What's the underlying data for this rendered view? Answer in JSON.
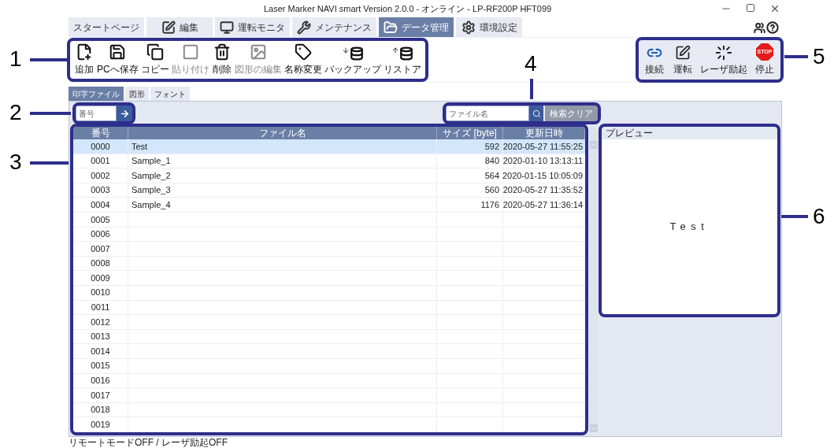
{
  "window": {
    "title": "Laser Marker NAVI smart  Version 2.0.0 - オンライン - LP-RF200P  HFT099"
  },
  "tabs": [
    {
      "label": "スタートページ",
      "selected": false
    },
    {
      "label": "編集",
      "selected": false
    },
    {
      "label": "運転モニタ",
      "selected": false
    },
    {
      "label": "メンテナンス",
      "selected": false
    },
    {
      "label": "データ管理",
      "selected": true
    },
    {
      "label": "環境設定",
      "selected": false
    }
  ],
  "toolbar": [
    {
      "label": "追加",
      "disabled": false
    },
    {
      "label": "PCへ保存",
      "disabled": false
    },
    {
      "label": "コピー",
      "disabled": false
    },
    {
      "label": "貼り付け",
      "disabled": true
    },
    {
      "label": "削除",
      "disabled": false
    },
    {
      "label": "図形の編集",
      "disabled": true
    },
    {
      "label": "名称変更",
      "disabled": false
    },
    {
      "label": "バックアップ",
      "disabled": false
    },
    {
      "label": "リストア",
      "disabled": false
    }
  ],
  "right_toolbar": [
    {
      "label": "接続"
    },
    {
      "label": "運転"
    },
    {
      "label": "レーザ励起"
    },
    {
      "label": "停止",
      "badge": "STOP"
    }
  ],
  "subtabs": [
    {
      "label": "印字ファイル",
      "selected": true
    },
    {
      "label": "図形",
      "selected": false
    },
    {
      "label": "フォント",
      "selected": false
    }
  ],
  "number_field": {
    "placeholder": "番号"
  },
  "search": {
    "placeholder": "ファイル名",
    "clear_button": "検索クリア"
  },
  "table": {
    "columns": [
      "番号",
      "ファイル名",
      "サイズ [byte]",
      "更新日時"
    ],
    "rows": [
      {
        "number": "0000",
        "name": "Test",
        "size": "592",
        "updated": "2020-05-27 11:55:25",
        "selected": true
      },
      {
        "number": "0001",
        "name": "Sample_1",
        "size": "840",
        "updated": "2020-01-10 13:13:11",
        "selected": false
      },
      {
        "number": "0002",
        "name": "Sample_2",
        "size": "564",
        "updated": "2020-01-15 10:05:09",
        "selected": false
      },
      {
        "number": "0003",
        "name": "Sample_3",
        "size": "560",
        "updated": "2020-05-27 11:35:52",
        "selected": false
      },
      {
        "number": "0004",
        "name": "Sample_4",
        "size": "1176",
        "updated": "2020-05-27 11:36:14",
        "selected": false
      },
      {
        "number": "0005",
        "selected": false
      },
      {
        "number": "0006",
        "selected": false
      },
      {
        "number": "0007",
        "selected": false
      },
      {
        "number": "0008",
        "selected": false
      },
      {
        "number": "0009",
        "selected": false
      },
      {
        "number": "0010",
        "selected": false
      },
      {
        "number": "0011",
        "selected": false
      },
      {
        "number": "0012",
        "selected": false
      },
      {
        "number": "0013",
        "selected": false
      },
      {
        "number": "0014",
        "selected": false
      },
      {
        "number": "0015",
        "selected": false
      },
      {
        "number": "0016",
        "selected": false
      },
      {
        "number": "0017",
        "selected": false
      },
      {
        "number": "0018",
        "selected": false
      },
      {
        "number": "0019",
        "selected": false
      }
    ]
  },
  "preview": {
    "title": "プレビュー",
    "text": "Test"
  },
  "status_bar": "リモートモードOFF / レーザ励起OFF",
  "callouts": [
    "1",
    "2",
    "3",
    "4",
    "5",
    "6"
  ]
}
